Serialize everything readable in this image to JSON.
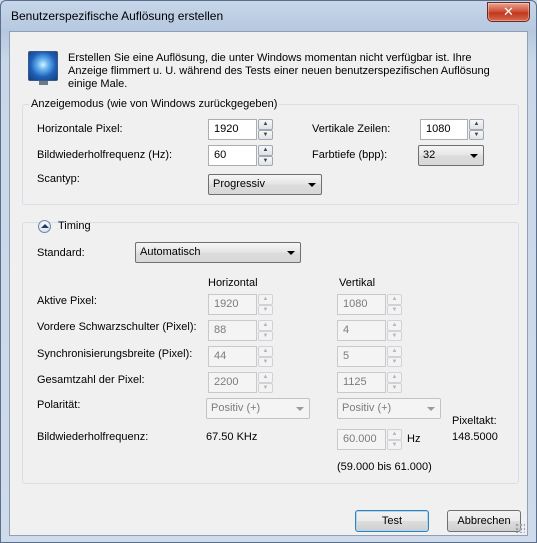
{
  "window": {
    "title": "Benutzerspezifische Auflösung erstellen",
    "close_glyph": "✕"
  },
  "intro": {
    "text": "Erstellen Sie eine Auflösung, die unter Windows momentan nicht verfügbar ist. Ihre Anzeige flimmert u. U. während des Tests einer neuen benutzerspezifischen Auflösung einige Male.",
    "icon": "monitor-icon"
  },
  "display_mode": {
    "group_label": "Anzeigemodus (wie von Windows zurückgegeben)",
    "horizontal_pixels": {
      "label": "Horizontale Pixel:",
      "value": "1920"
    },
    "vertical_lines": {
      "label": "Vertikale Zeilen:",
      "value": "1080"
    },
    "refresh_rate": {
      "label": "Bildwiederholfrequenz (Hz):",
      "value": "60"
    },
    "color_depth": {
      "label": "Farbtiefe (bpp):",
      "value": "32"
    },
    "scan_type": {
      "label": "Scantyp:",
      "value": "Progressiv"
    }
  },
  "timing": {
    "label": "Timing",
    "standard_label": "Standard:",
    "standard_value": "Automatisch",
    "col_horizontal": "Horizontal",
    "col_vertical": "Vertikal",
    "rows": [
      {
        "label": "Aktive Pixel:",
        "h": "1920",
        "v": "1080"
      },
      {
        "label": "Vordere Schwarzschulter (Pixel):",
        "h": "88",
        "v": "4"
      },
      {
        "label": "Synchronisierungsbreite (Pixel):",
        "h": "44",
        "v": "5"
      },
      {
        "label": "Gesamtzahl der Pixel:",
        "h": "2200",
        "v": "1125"
      }
    ],
    "polarity": {
      "label": "Polarität:",
      "h": "Positiv (+)",
      "v": "Positiv (+)"
    },
    "refresh": {
      "label": "Bildwiederholfrequenz:",
      "h_value": "67.50 KHz",
      "v_value": "60.000",
      "unit": "Hz",
      "range": "(59.000 bis 61.000)"
    },
    "pixel_clock": {
      "label": "Pixeltakt:",
      "value": "148.5000"
    }
  },
  "buttons": {
    "test": "Test",
    "cancel": "Abbrechen"
  }
}
